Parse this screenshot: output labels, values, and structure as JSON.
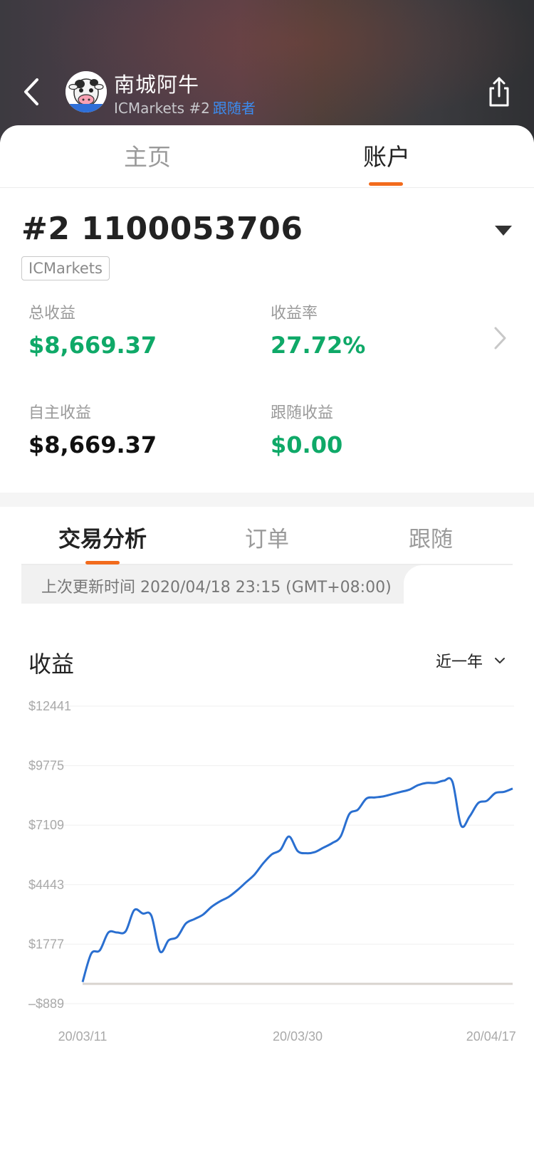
{
  "header": {
    "name": "南城阿牛",
    "broker": "ICMarkets #2",
    "follower_label": "跟随者"
  },
  "main_tabs": [
    {
      "label": "主页",
      "active": false
    },
    {
      "label": "账户",
      "active": true
    }
  ],
  "account": {
    "id": "#2 1100053706",
    "broker_tag": "ICMarkets"
  },
  "stats": {
    "total_profit_label": "总收益",
    "total_profit_value": "$8,669.37",
    "return_rate_label": "收益率",
    "return_rate_value": "27.72%",
    "self_profit_label": "自主收益",
    "self_profit_value": "$8,669.37",
    "follow_profit_label": "跟随收益",
    "follow_profit_value": "$0.00"
  },
  "sub_tabs": [
    {
      "label": "交易分析",
      "active": true
    },
    {
      "label": "订单",
      "active": false
    },
    {
      "label": "跟随",
      "active": false
    }
  ],
  "update_text": "上次更新时间 2020/04/18 23:15 (GMT+08:00)",
  "chart_section": {
    "title": "收益",
    "range": "近一年"
  },
  "colors": {
    "accent": "#f26b1d",
    "positive": "#0fa968",
    "line": "#2a6fd0",
    "link": "#3b8cf0"
  },
  "chart_data": {
    "type": "line",
    "y_ticks": [
      "$12441",
      "$9775",
      "$7109",
      "$4443",
      "$1777",
      "–$889"
    ],
    "y_tick_values": [
      12441,
      9775,
      7109,
      4443,
      1777,
      -889
    ],
    "ylim": [
      -889,
      12441
    ],
    "x_ticks": [
      "20/03/11",
      "20/03/30",
      "20/04/17"
    ],
    "x_tick_positions": [
      0,
      0.5,
      0.95
    ],
    "baseline": 0,
    "grid": true,
    "x": [
      0,
      0.02,
      0.04,
      0.06,
      0.08,
      0.1,
      0.12,
      0.14,
      0.16,
      0.18,
      0.2,
      0.22,
      0.24,
      0.26,
      0.28,
      0.3,
      0.32,
      0.34,
      0.36,
      0.38,
      0.4,
      0.42,
      0.44,
      0.46,
      0.48,
      0.5,
      0.52,
      0.54,
      0.56,
      0.58,
      0.6,
      0.62,
      0.64,
      0.66,
      0.68,
      0.7,
      0.72,
      0.74,
      0.76,
      0.78,
      0.8,
      0.82,
      0.84,
      0.86,
      0.88,
      0.9,
      0.92,
      0.94,
      0.96,
      0.98,
      1.0
    ],
    "values": [
      80,
      1350,
      1500,
      2300,
      2300,
      2350,
      3300,
      3150,
      3050,
      1450,
      1950,
      2100,
      2700,
      2900,
      3100,
      3450,
      3700,
      3900,
      4200,
      4550,
      4900,
      5400,
      5800,
      6000,
      6600,
      5950,
      5850,
      5900,
      6100,
      6300,
      6600,
      7600,
      7800,
      8300,
      8350,
      8400,
      8500,
      8600,
      8700,
      8900,
      9000,
      9000,
      9100,
      9050,
      7100,
      7500,
      8100,
      8200,
      8550,
      8600,
      8750
    ]
  }
}
